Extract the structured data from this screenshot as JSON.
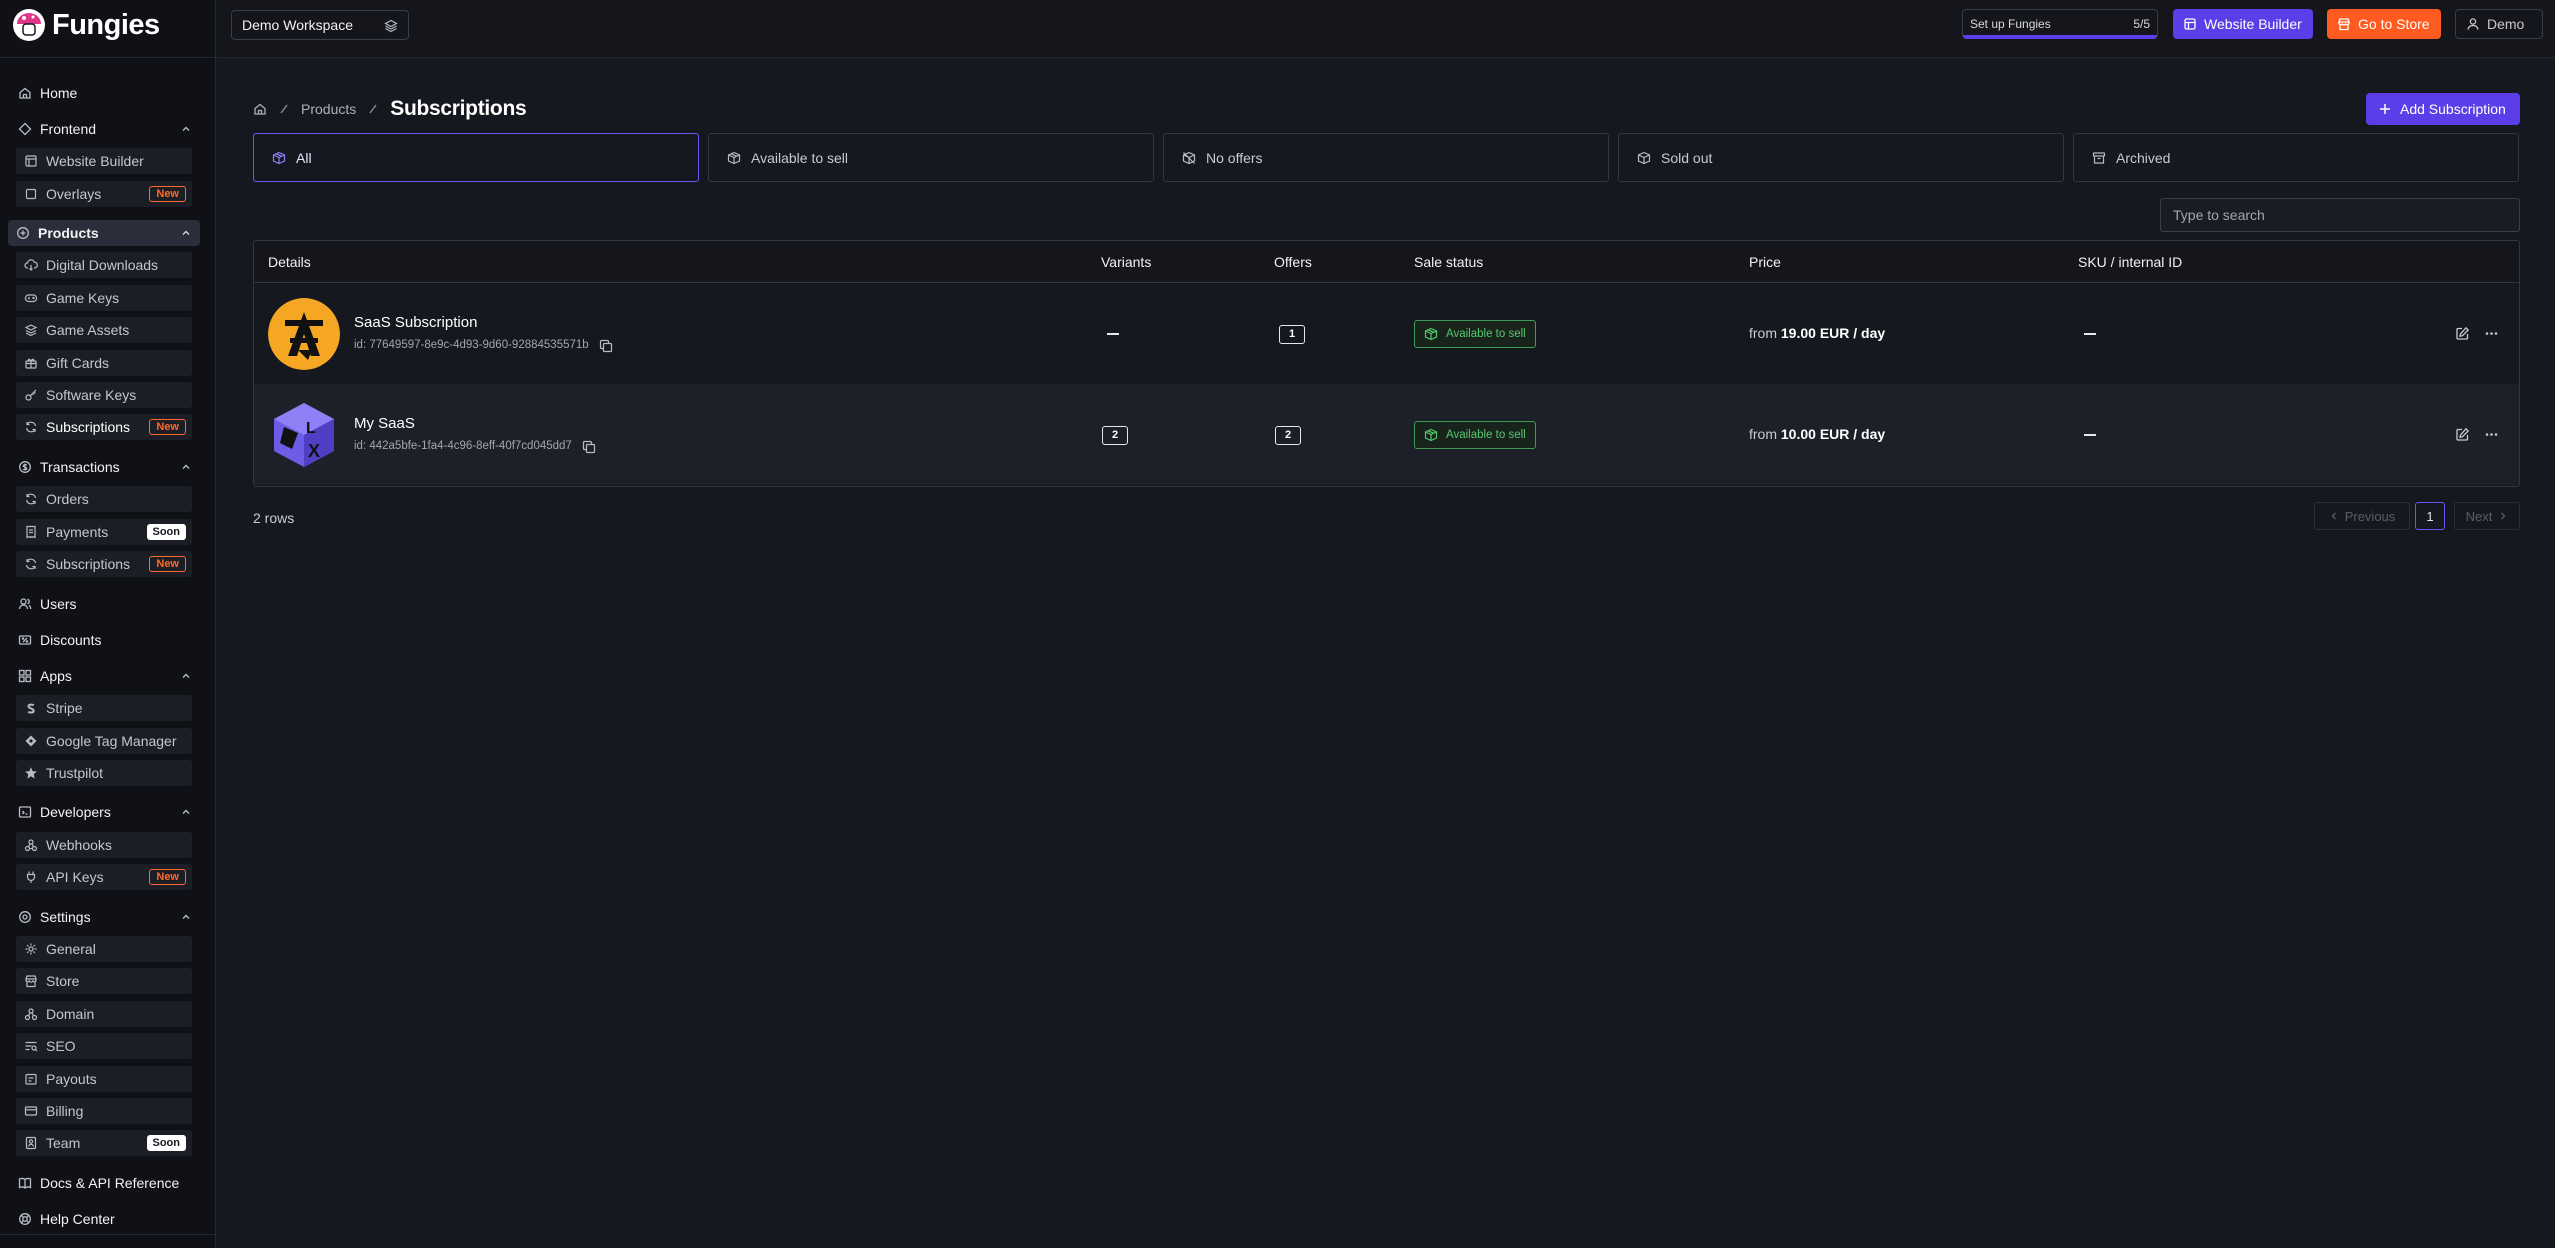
{
  "app": {
    "name": "Fungies"
  },
  "workspace": {
    "name": "Demo Workspace"
  },
  "topbar": {
    "setup_label": "Set up Fungies",
    "setup_count": "5/5",
    "setup_progress": 1.0,
    "website_builder": "Website Builder",
    "go_to_store": "Go to Store",
    "user": "Demo"
  },
  "sidebar": {
    "home": "Home",
    "frontend": {
      "label": "Frontend",
      "items": [
        {
          "label": "Website Builder",
          "icon": "layout-icon"
        },
        {
          "label": "Overlays",
          "icon": "overlay-icon",
          "badge": "New"
        }
      ]
    },
    "products": {
      "label": "Products",
      "items": [
        {
          "label": "Digital Downloads",
          "icon": "cloud-download-icon"
        },
        {
          "label": "Game Keys",
          "icon": "gamepad-icon"
        },
        {
          "label": "Game Assets",
          "icon": "assets-icon"
        },
        {
          "label": "Gift Cards",
          "icon": "gift-icon"
        },
        {
          "label": "Software Keys",
          "icon": "key-icon"
        },
        {
          "label": "Subscriptions",
          "icon": "refresh-icon",
          "badge": "New"
        }
      ]
    },
    "transactions": {
      "label": "Transactions",
      "items": [
        {
          "label": "Orders",
          "icon": "orders-icon"
        },
        {
          "label": "Payments",
          "icon": "receipt-icon",
          "badge": "Soon"
        },
        {
          "label": "Subscriptions",
          "icon": "refresh-icon",
          "badge": "New"
        }
      ]
    },
    "users": "Users",
    "discounts": "Discounts",
    "apps": {
      "label": "Apps",
      "items": [
        {
          "label": "Stripe",
          "icon": "stripe-icon"
        },
        {
          "label": "Google Tag Manager",
          "icon": "tag-manager-icon"
        },
        {
          "label": "Trustpilot",
          "icon": "star-icon"
        }
      ]
    },
    "developers": {
      "label": "Developers",
      "items": [
        {
          "label": "Webhooks",
          "icon": "webhook-icon"
        },
        {
          "label": "API Keys",
          "icon": "plug-icon",
          "badge": "New"
        }
      ]
    },
    "settings": {
      "label": "Settings",
      "items": [
        {
          "label": "General",
          "icon": "gear-icon"
        },
        {
          "label": "Store",
          "icon": "store-icon"
        },
        {
          "label": "Domain",
          "icon": "domain-icon"
        },
        {
          "label": "SEO",
          "icon": "seo-icon"
        },
        {
          "label": "Payouts",
          "icon": "payouts-icon"
        },
        {
          "label": "Billing",
          "icon": "card-icon"
        },
        {
          "label": "Team",
          "icon": "team-icon",
          "badge": "Soon"
        }
      ]
    },
    "docs": "Docs & API Reference",
    "help": "Help Center"
  },
  "breadcrumb": {
    "products": "Products",
    "current": "Subscriptions"
  },
  "add_button": "Add Subscription",
  "tabs": [
    {
      "label": "All",
      "active": true
    },
    {
      "label": "Available to sell",
      "active": false
    },
    {
      "label": "No offers",
      "active": false
    },
    {
      "label": "Sold out",
      "active": false
    },
    {
      "label": "Archived",
      "active": false
    }
  ],
  "search": {
    "placeholder": "Type to search"
  },
  "table": {
    "columns": [
      "Details",
      "Variants",
      "Offers",
      "Sale status",
      "Price",
      "SKU / internal ID"
    ],
    "rows": [
      {
        "name": "SaaS Subscription",
        "id": "id: 77649597-8e9c-4d93-9d60-92884535571b",
        "variants": "—",
        "offers": "1",
        "status": "Available to sell",
        "price_prefix": "from",
        "price": "19.00 EUR / day",
        "sku": "—"
      },
      {
        "name": "My SaaS",
        "id": "id: 442a5bfe-1fa4-4c96-8eff-40f7cd045dd7",
        "variants": "2",
        "offers": "2",
        "status": "Available to sell",
        "price_prefix": "from",
        "price": "10.00 EUR / day",
        "sku": "—"
      }
    ]
  },
  "footer": {
    "row_count": "2 rows",
    "previous": "Previous",
    "page": "1",
    "next": "Next"
  },
  "colors": {
    "accent": "#5b3ee8",
    "orange": "#ff5a1f",
    "success": "#56c870",
    "bg": "#16181f"
  }
}
